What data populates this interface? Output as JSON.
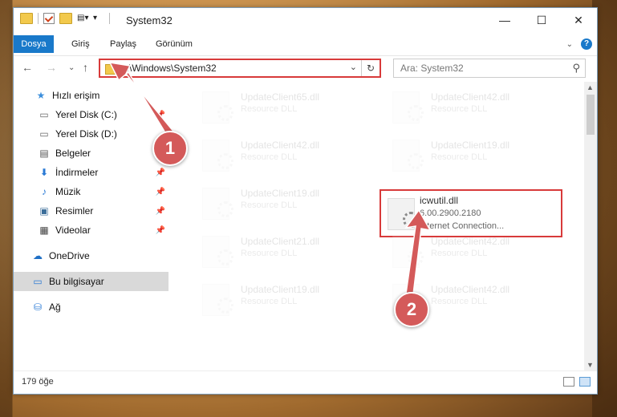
{
  "window": {
    "title": "System32",
    "controls": {
      "minimize": "—",
      "maximize": "☐",
      "close": "✕"
    }
  },
  "ribbon": {
    "tabs": [
      "Dosya",
      "Giriş",
      "Paylaş",
      "Görünüm"
    ]
  },
  "navigation": {
    "address": "C:\\Windows\\System32",
    "search_placeholder": "Ara: System32"
  },
  "sidebar": {
    "items": [
      {
        "label": "Hızlı erişim",
        "icon": "star-icon"
      },
      {
        "label": "Yerel Disk (C:)",
        "icon": "drive-icon",
        "pinned": true
      },
      {
        "label": "Yerel Disk (D:)",
        "icon": "drive-icon"
      },
      {
        "label": "Belgeler",
        "icon": "document-icon"
      },
      {
        "label": "İndirmeler",
        "icon": "download-icon",
        "pinned": true
      },
      {
        "label": "Müzik",
        "icon": "music-icon",
        "pinned": true
      },
      {
        "label": "Resimler",
        "icon": "pictures-icon",
        "pinned": true
      },
      {
        "label": "Videolar",
        "icon": "video-icon",
        "pinned": true
      },
      {
        "label": "OneDrive",
        "icon": "cloud-icon"
      },
      {
        "label": "Bu bilgisayar",
        "icon": "computer-icon",
        "selected": true
      },
      {
        "label": "Ağ",
        "icon": "network-icon"
      }
    ]
  },
  "files": [
    {
      "name": "UpdateClient65.dll",
      "type": "Resource DLL"
    },
    {
      "name": "UpdateClient42.dll",
      "type": "Resource DLL"
    },
    {
      "name": "UpdateClient42.dll",
      "type": "Resource DLL"
    },
    {
      "name": "UpdateClient19.dll",
      "type": "Resource DLL"
    },
    {
      "name": "UpdateClient19.dll",
      "type": "Resource DLL"
    },
    {
      "name": "icwutil.dll",
      "version": "6.00.2900.2180",
      "description": "Internet Connection...",
      "highlighted": true
    },
    {
      "name": "UpdateClient21.dll",
      "type": "Resource DLL"
    },
    {
      "name": "UpdateClient42.dll",
      "type": "Resource DLL"
    },
    {
      "name": "UpdateClient19.dll",
      "type": "Resource DLL"
    },
    {
      "name": "UpdateClient42.dll",
      "type": "Resource DLL"
    }
  ],
  "status": {
    "count": "179 öğe"
  },
  "annotations": {
    "step1": "1",
    "step2": "2",
    "color": "#d45a5a"
  }
}
